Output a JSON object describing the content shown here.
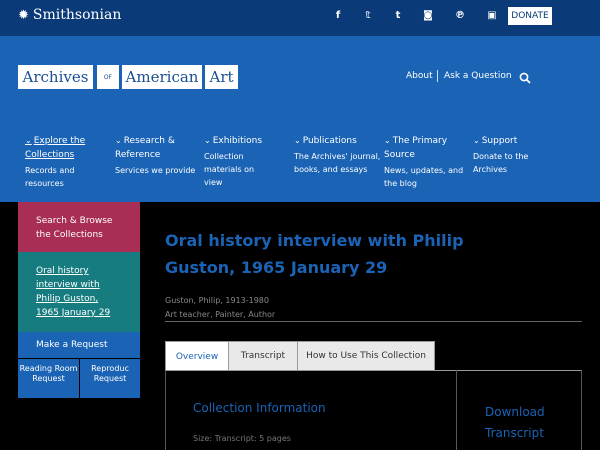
{
  "topbar": {
    "brand": "Smithsonian",
    "social": [
      "f",
      "𝕥",
      "t",
      "◙",
      "℗",
      "▣"
    ],
    "social_icons": [
      "facebook-icon",
      "twitter-icon",
      "tumblr-icon",
      "instagram-icon",
      "pinterest-icon",
      "youtube-icon"
    ],
    "donate": "DONATE"
  },
  "logo": {
    "word1": "Archives",
    "of": "OF",
    "word2": "American",
    "word3": "Art"
  },
  "utility": {
    "about": "About",
    "ask": "Ask a Question"
  },
  "nav": [
    {
      "title": "Explore the Collections",
      "desc": "Records and resources"
    },
    {
      "title": "Research & Reference",
      "desc": "Services we provide"
    },
    {
      "title": "Exhibitions",
      "desc": "Collection materials on view"
    },
    {
      "title": "Publications",
      "desc": "The Archives' journal, books, and essays"
    },
    {
      "title": "The Primary Source",
      "desc": "News, updates, and the blog"
    },
    {
      "title": "Support",
      "desc": "Donate to the Archives"
    }
  ],
  "sidebar": {
    "browse": "Search & Browse the Collections",
    "current": "Oral history interview with Philip Guston, 1965 January 29",
    "request": "Make a Request",
    "reading_room": "Reading Room Request",
    "reproduction": "Reproduc Request"
  },
  "main": {
    "title": "Oral history interview with Philip Guston, 1965 January 29",
    "creator_name": "Guston, Philip, 1913-1980",
    "creator_roles": "Art teacher, Painter, Author",
    "tabs": [
      "Overview",
      "Transcript",
      "How to Use This Collection"
    ],
    "collection_info": "Collection Information",
    "size": "Size: Transcript: 5 pages",
    "download": "Download Transcript"
  },
  "colors": {
    "navy": "#0a3a78",
    "blue": "#1a63b5",
    "magenta": "#a82e55",
    "teal": "#167c80"
  }
}
